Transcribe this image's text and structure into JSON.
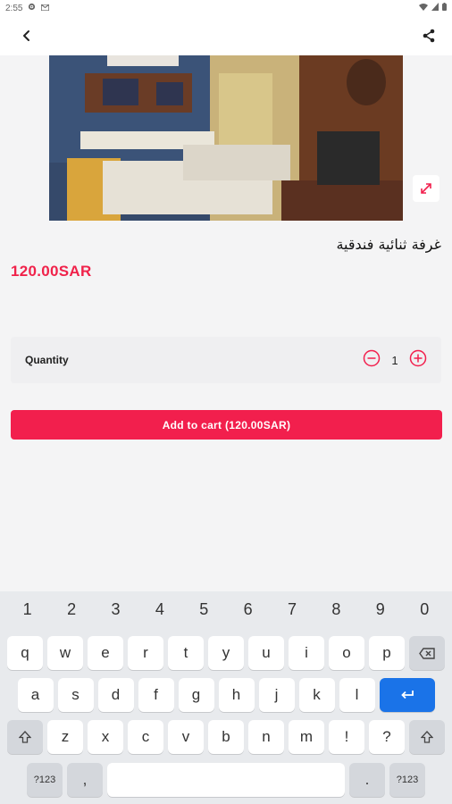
{
  "status_bar": {
    "time": "2:55"
  },
  "product": {
    "title": "غرفة ثنائية فندقية",
    "price": "120.00SAR"
  },
  "quantity": {
    "label": "Quantity",
    "value": "1"
  },
  "add_to_cart_label": "Add to cart (120.00SAR)",
  "keyboard": {
    "numbers": [
      "1",
      "2",
      "3",
      "4",
      "5",
      "6",
      "7",
      "8",
      "9",
      "0"
    ],
    "row1": [
      "q",
      "w",
      "e",
      "r",
      "t",
      "y",
      "u",
      "i",
      "o",
      "p"
    ],
    "row2": [
      "a",
      "s",
      "d",
      "f",
      "g",
      "h",
      "j",
      "k",
      "l"
    ],
    "row3": [
      "z",
      "x",
      "c",
      "v",
      "b",
      "n",
      "m",
      "!",
      "?"
    ],
    "symbols_label": "?123",
    "comma": ",",
    "period": "."
  },
  "colors": {
    "accent": "#f21f4d",
    "enter": "#1a73e8"
  }
}
